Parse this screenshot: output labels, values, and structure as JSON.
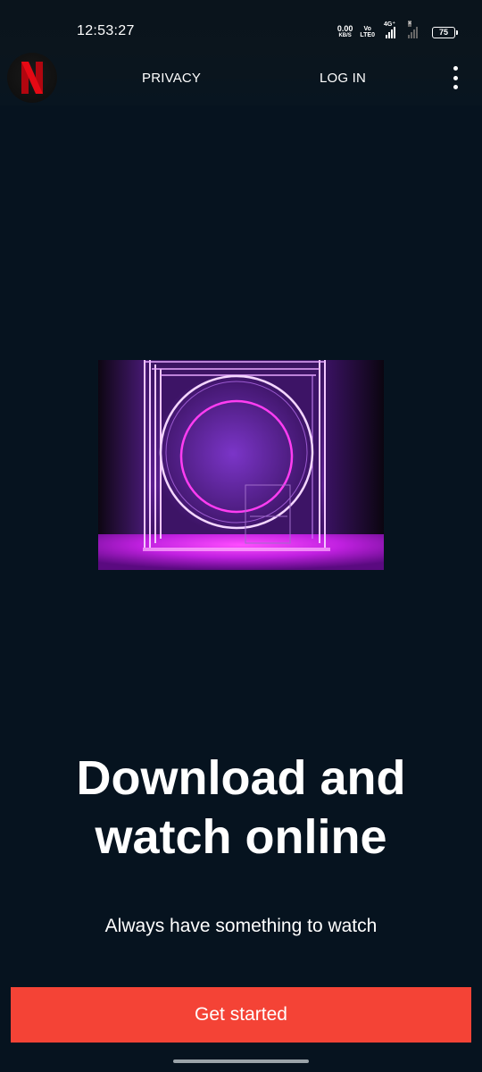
{
  "status_bar": {
    "time": "12:53:27",
    "net_speed_value": "0.00",
    "net_speed_unit": "KB/S",
    "volte_top": "Vo",
    "volte_bottom": "LTE0",
    "network_type": "4G⁺",
    "battery_level": "75"
  },
  "header": {
    "logo_letter": "N",
    "privacy_label": "PRIVACY",
    "login_label": "LOG IN",
    "more_icon": "more-vertical-icon"
  },
  "hero": {
    "image_description_icon": "neon-circle-image"
  },
  "main": {
    "headline_line1": "Download and",
    "headline_line2": "watch online",
    "subtitle": "Always have something to watch",
    "cta_label": "Get started"
  },
  "colors": {
    "background": "#06131f",
    "brand_red": "#e50914",
    "cta_red": "#f44336",
    "neon_purple": "#b026ff",
    "neon_pink": "#ff3df2"
  }
}
